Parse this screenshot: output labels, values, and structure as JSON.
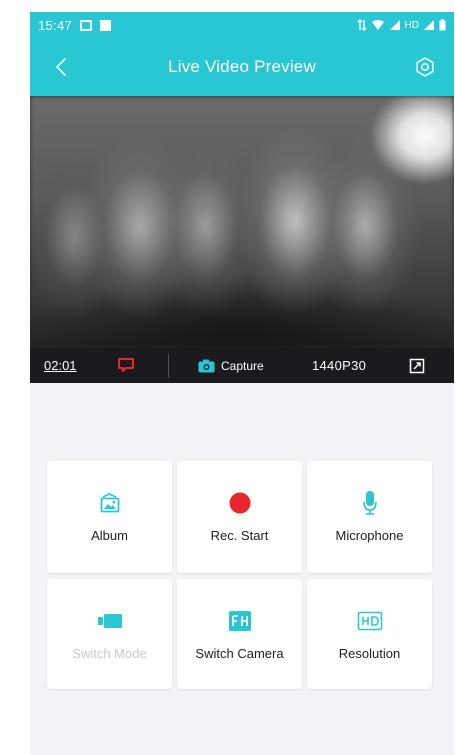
{
  "status_bar": {
    "time": "15:47",
    "right_text": "HD"
  },
  "nav": {
    "title": "Live Video Preview",
    "back_icon": "chevron-left-icon",
    "settings_icon": "gear-icon"
  },
  "video": {
    "recording_time": "02:01",
    "capture_label": "Capture",
    "resolution": "1440P30"
  },
  "controls": [
    {
      "label": "Album",
      "icon": "album-icon",
      "enabled": true
    },
    {
      "label": "Rec. Start",
      "icon": "record-icon",
      "enabled": true
    },
    {
      "label": "Microphone",
      "icon": "microphone-icon",
      "enabled": true
    },
    {
      "label": "Switch Mode",
      "icon": "video-camera-icon",
      "enabled": false
    },
    {
      "label": "Switch Camera",
      "icon": "switch-camera-icon",
      "enabled": true
    },
    {
      "label": "Resolution",
      "icon": "hd-icon",
      "enabled": true
    }
  ],
  "colors": {
    "accent": "#29c6d3",
    "record": "#e8262b",
    "disabled": "#c7c9cd",
    "background": "#f2f3f6"
  }
}
